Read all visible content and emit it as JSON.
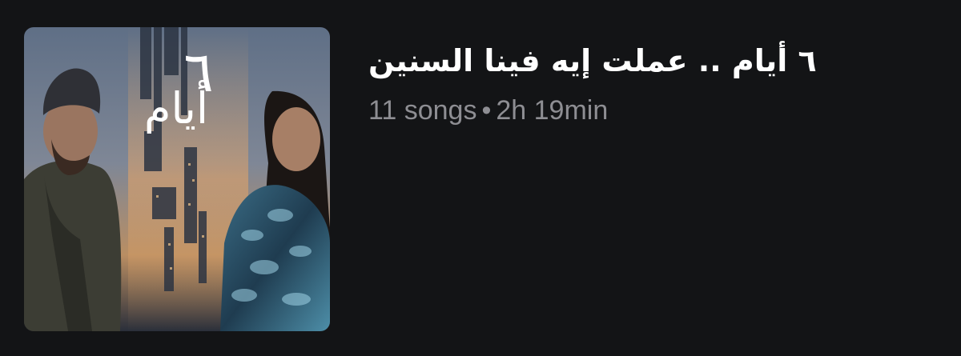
{
  "album": {
    "title": "٦ أيام .. عملت إيه فينا السنين",
    "song_count": "11 songs",
    "separator": "•",
    "duration": "2h 19min",
    "artwork": {
      "description_icon": "album-artwork-image",
      "title_text": "أيام",
      "title_numeral": "٦"
    }
  },
  "colors": {
    "background": "#131416",
    "title": "#ffffff",
    "meta": "#8e8e93"
  }
}
